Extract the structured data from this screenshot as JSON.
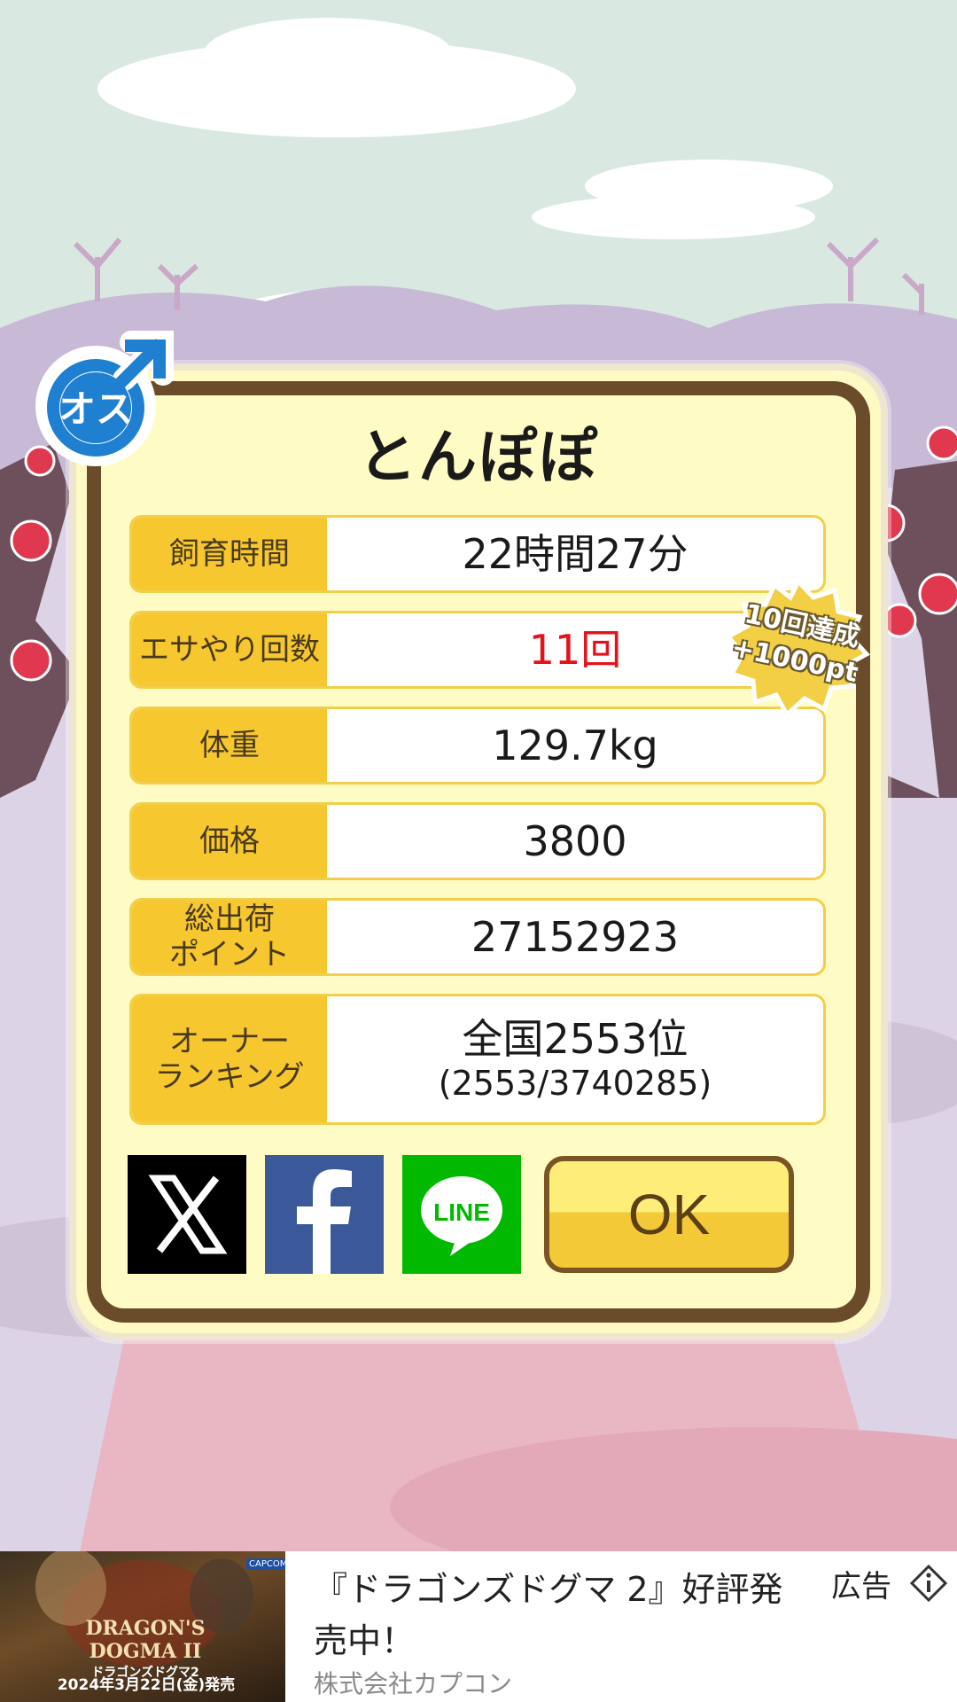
{
  "pig": {
    "name": "とんぽぽ",
    "gender_icon_text": "オス"
  },
  "stats": [
    {
      "label": "飼育時間",
      "value": "22時間27分"
    },
    {
      "label": "エサやり回数",
      "value": "11回"
    },
    {
      "label": "体重",
      "value": "129.7kg"
    },
    {
      "label": "価格",
      "value": "3800"
    },
    {
      "label": "総出荷\nポイント",
      "value": "27152923"
    },
    {
      "label": "オーナー\nランキング",
      "value": "全国2553位",
      "sub": "(2553/3740285)"
    }
  ],
  "badge": {
    "line1": "10回達成",
    "line2": "+1000pt"
  },
  "share": {
    "line_text": "LINE"
  },
  "ok_button": {
    "label": "OK"
  },
  "ad": {
    "title": "『ドラゴンズドグマ 2』好評発売中！",
    "advertiser": "株式会社カプコン",
    "label": "広告",
    "image_logo": "DRAGON'S DOGMA II",
    "image_brand": "CAPCOM",
    "image_caption": "ドラゴンズドグマ2",
    "image_date": "2024年3月22日(金)発売"
  },
  "colors": {
    "sky": "#d9e9e1",
    "panel": "#fffbc4",
    "label_bg": "#f6c72e",
    "frame": "#6b4c2a",
    "highlight_red": "#e5121b"
  }
}
